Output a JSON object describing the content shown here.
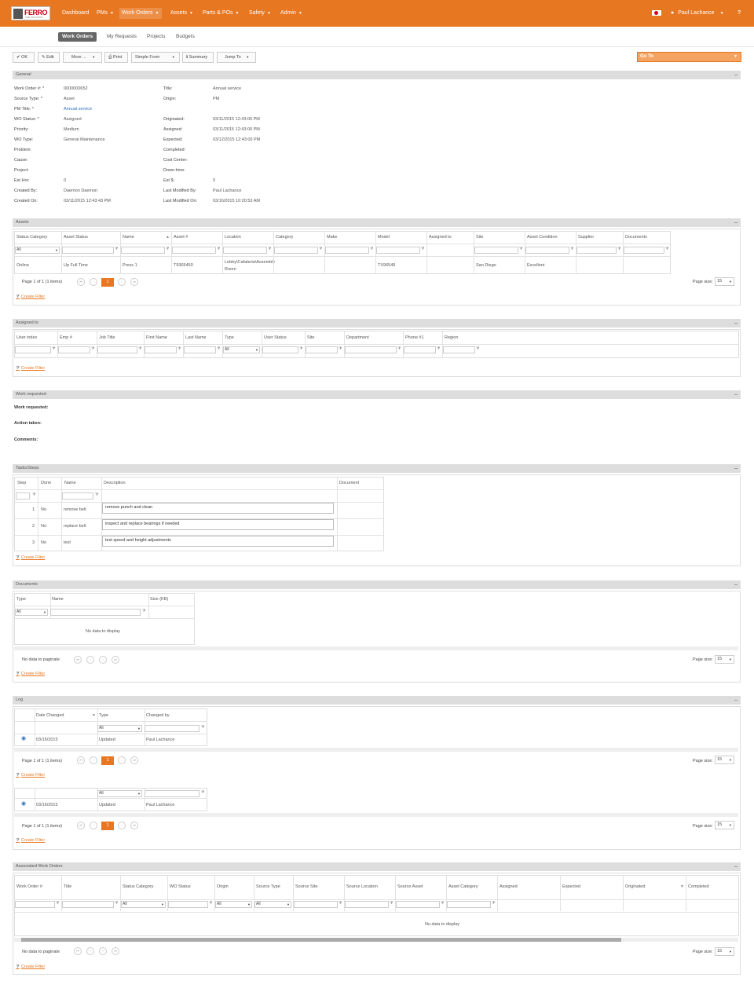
{
  "nav": {
    "logo_text": "FERRO",
    "logo_sub": "THE SOLUTION",
    "items": [
      "Dashboard",
      "PMs",
      "Work Orders",
      "Assets",
      "Parts & POs",
      "Safety",
      "Admin"
    ],
    "user": "Paul Lachance",
    "help": "?"
  },
  "subnav": [
    "Work Orders",
    "My Requests",
    "Projects",
    "Budgets"
  ],
  "toolbar": {
    "ok": "OK",
    "edit": "Edit",
    "more": "More ...",
    "print": "Print",
    "simple_form": "Simple Form",
    "summary": "Summary",
    "jump_to": "Jump To",
    "goto": "Go To"
  },
  "general": {
    "header": "General",
    "left": [
      {
        "label": "Work Order #: *",
        "value": "0000000652"
      },
      {
        "label": "Source Type: *",
        "value": "Asset"
      },
      {
        "label": "PM Title: *",
        "value": "Annual service"
      },
      {
        "label": "WO Status: *",
        "value": "Assigned"
      },
      {
        "label": "Priority:",
        "value": "Medium"
      },
      {
        "label": "WO Type:",
        "value": "General Maintenance"
      },
      {
        "label": "Problem:",
        "value": ""
      },
      {
        "label": "Cause:",
        "value": ""
      },
      {
        "label": "Project:",
        "value": ""
      },
      {
        "label": "Est Hrs:",
        "value": "0"
      },
      {
        "label": "Created By:",
        "value": "Daemon Daemon"
      },
      {
        "label": "Created On:",
        "value": "03/11/2015 12:43:43 PM"
      }
    ],
    "right": [
      {
        "label": "Title:",
        "value": "Annual service"
      },
      {
        "label": "Origin:",
        "value": "PM"
      },
      {
        "label": "",
        "value": ""
      },
      {
        "label": "Originated:",
        "value": "03/11/2015 12:43:00 PM"
      },
      {
        "label": "Assigned:",
        "value": "03/11/2015 12:43:00 PM"
      },
      {
        "label": "Expected:",
        "value": "03/12/2015 12:43:00 PM"
      },
      {
        "label": "Completed:",
        "value": ""
      },
      {
        "label": "Cost Center:",
        "value": ""
      },
      {
        "label": "Down-time:",
        "value": ""
      },
      {
        "label": "Est $:",
        "value": "0"
      },
      {
        "label": "Last Modified By:",
        "value": "Paul Lachance"
      },
      {
        "label": "Last Modified On:",
        "value": "03/16/2015 10:20:53 AM"
      }
    ]
  },
  "assets": {
    "header": "Assets",
    "columns": [
      "Status Category",
      "Asset Status",
      "Name",
      "Asset #",
      "Location",
      "Category",
      "Make",
      "Model",
      "Assigned to",
      "Site",
      "Asset Condition",
      "Supplier",
      "Documents"
    ],
    "filter_all": "All",
    "row": [
      "Online",
      "Up Full Time",
      "Press 1",
      "T9365450",
      "Lobby\\Cafateria\\Assembly Room",
      "",
      "",
      "TX96549",
      "",
      "San Diego",
      "Excellent",
      "",
      ""
    ],
    "pager": "Page 1 of 1 (1 items)",
    "page": "1",
    "page_size_label": "Page size:",
    "page_size": "15",
    "create_filter": "Create Filter"
  },
  "assigned": {
    "header": "Assigned to",
    "columns": [
      "User index",
      "Emp #",
      "Job Title",
      "First Name",
      "Last Name",
      "Type",
      "User Status",
      "Site",
      "Department",
      "Phone #1",
      "Region"
    ],
    "filter_all": "All",
    "create_filter": "Create Filter"
  },
  "work_requested": {
    "header": "Work requested",
    "labels": [
      "Work requested:",
      "Action taken:",
      "Comments:"
    ]
  },
  "tasks": {
    "header": "Tasks/Steps",
    "columns": [
      "Step",
      "Done",
      "Name",
      "Description",
      "Document"
    ],
    "rows": [
      {
        "step": "1",
        "done": "No",
        "name": "remove belt",
        "desc": "remove punch and clean"
      },
      {
        "step": "2",
        "done": "No",
        "name": "replace belt",
        "desc": "inspect and replace bearings if needed"
      },
      {
        "step": "3",
        "done": "No",
        "name": "test",
        "desc": "test speed and height adjustments"
      }
    ],
    "create_filter": "Create Filter"
  },
  "documents": {
    "header": "Documents",
    "columns": [
      "Type",
      "Name",
      "Size (KB)"
    ],
    "filter_all": "All",
    "empty": "No data to display",
    "pager": "No data to paginate",
    "page_size_label": "Page size:",
    "page_size": "15",
    "create_filter": "Create Filter"
  },
  "log": {
    "header": "Log",
    "columns": [
      "Date Changed",
      "Type",
      "Changed by"
    ],
    "filter_all": "All",
    "row": {
      "date": "03/16/2015",
      "type": "Updated",
      "by": "Paul Lachance"
    },
    "pager": "Page 1 of 1 (1 items)",
    "page": "1",
    "page_size_label": "Page size:",
    "page_size": "15",
    "create_filter": "Create Filter"
  },
  "associated": {
    "header": "Associated Work Orders",
    "columns": [
      "Work Order #",
      "Title",
      "Status Category",
      "WO Status",
      "Origin",
      "Source Type",
      "Source Site",
      "Source Location",
      "Source Asset",
      "Asset Category",
      "Assigned",
      "Expected",
      "Originated",
      "Completed"
    ],
    "filter_all": "All",
    "empty": "No data to display",
    "pager": "No data to paginate",
    "page_size_label": "Page size:",
    "page_size": "15",
    "create_filter": "Create Filter"
  },
  "colors": {
    "accent": "#e87722",
    "link": "#2a6ebb",
    "header_bg": "#dddddd"
  }
}
